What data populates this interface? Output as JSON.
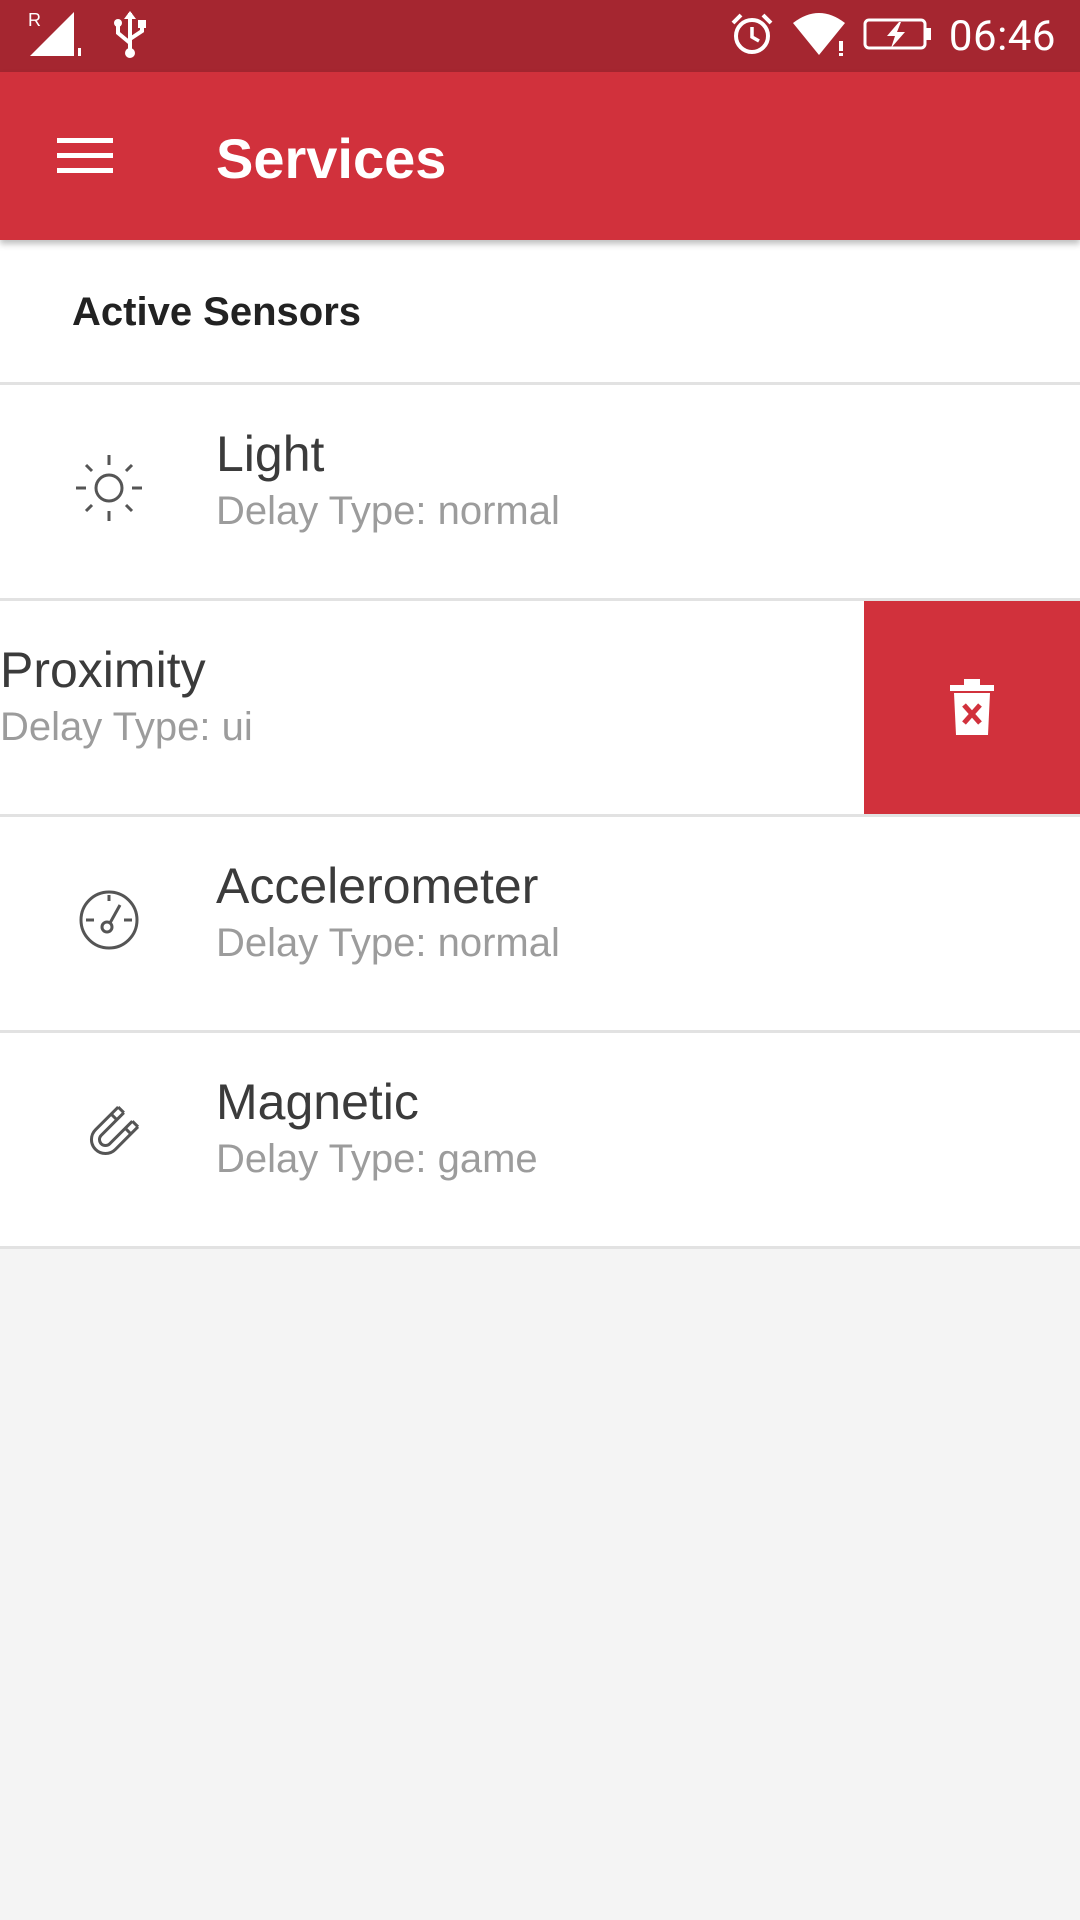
{
  "status_bar": {
    "time": "06:46",
    "icons": [
      "signal-roaming-icon",
      "usb-icon",
      "alarm-icon",
      "wifi-icon",
      "battery-charging-icon"
    ]
  },
  "app_bar": {
    "title": "Services",
    "menu_icon": "hamburger-menu-icon"
  },
  "section": {
    "title": "Active Sensors"
  },
  "sensors": [
    {
      "name": "Light",
      "delay": "Delay Type: normal",
      "icon": "sun-icon"
    },
    {
      "name": "Proximity",
      "delay": "Delay Type: ui",
      "icon": "delete-icon",
      "swiped": true
    },
    {
      "name": "Accelerometer",
      "delay": "Delay Type: normal",
      "icon": "gauge-icon"
    },
    {
      "name": "Magnetic",
      "delay": "Delay Type: game",
      "icon": "magnet-icon"
    }
  ],
  "colors": {
    "primary": "#d1313c",
    "status_bar": "#a52630",
    "background": "#f4f4f4",
    "divider": "#e2e2e2",
    "title_text": "#3b3b3b",
    "secondary_text": "#9c9c9c"
  }
}
